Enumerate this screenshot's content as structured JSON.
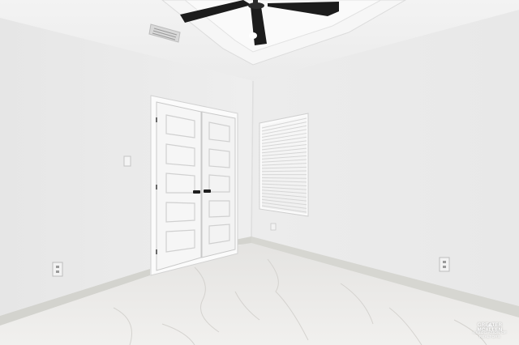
{
  "scene": {
    "description_colors": {
      "wall": "#ededed",
      "wall_shadow": "#e2e2e2",
      "ceiling": "#f4f4f4",
      "floor": "#e9e8e6",
      "baseboard": "#d4d4cf",
      "door": "#f7f7f7",
      "fan": "#1c1c1c"
    }
  },
  "watermark": {
    "line1": "GREATER MCALLEN",
    "line2": "ASSOCIATION OF REALTORS"
  }
}
